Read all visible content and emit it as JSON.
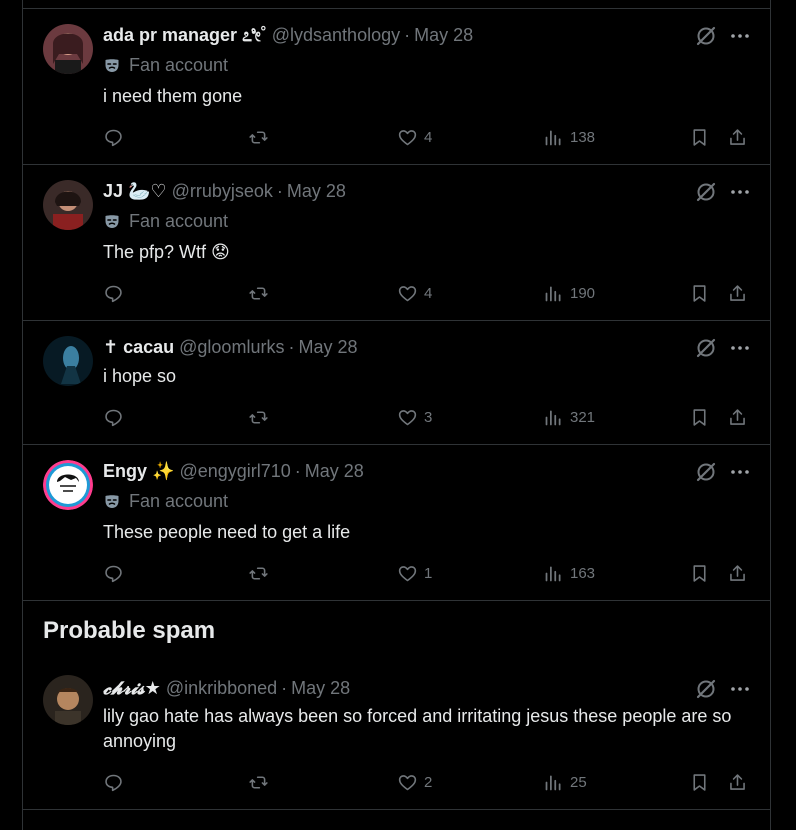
{
  "replies": [
    {
      "display_name": "ada pr manager ೭ೀ˚",
      "handle": "@lydsanthology",
      "dot": "·",
      "date": "May 28",
      "badge": "Fan account",
      "text": "i need them gone",
      "likes": "4",
      "views": "138"
    },
    {
      "display_name": "JJ 🦢♡",
      "handle": "@rrubyjseok",
      "dot": "·",
      "date": "May 28",
      "badge": "Fan account",
      "text": "The pfp? Wtf 😟",
      "likes": "4",
      "views": "190"
    },
    {
      "display_name": "✝ cacau",
      "handle": "@gloomlurks",
      "dot": "·",
      "date": "May 28",
      "text": "i hope so",
      "likes": "3",
      "views": "321"
    },
    {
      "display_name": "Engy ✨",
      "handle": "@engygirl710",
      "dot": "·",
      "date": "May 28",
      "badge": "Fan account",
      "text": "These people need to get a life",
      "likes": "1",
      "views": "163"
    },
    {
      "display_name": "𝓬𝓱𝓻𝓲𝓼★",
      "handle": "@inkribboned",
      "dot": "·",
      "date": "May 28",
      "text": "lily gao hate has always been so forced and irritating jesus these people are so annoying",
      "likes": "2",
      "views": "25"
    }
  ],
  "section_title": "Probable spam",
  "icons": {
    "grok": "slashed-circle-icon",
    "more": "more-icon",
    "reply": "reply-icon",
    "repost": "repost-icon",
    "like": "heart-icon",
    "views": "views-icon",
    "bookmark": "bookmark-icon",
    "share": "share-icon",
    "badge": "mask-icon"
  },
  "colors": {
    "background": "#000000",
    "text": "#e7e9ea",
    "muted": "#71767b",
    "border": "#2f3336"
  }
}
